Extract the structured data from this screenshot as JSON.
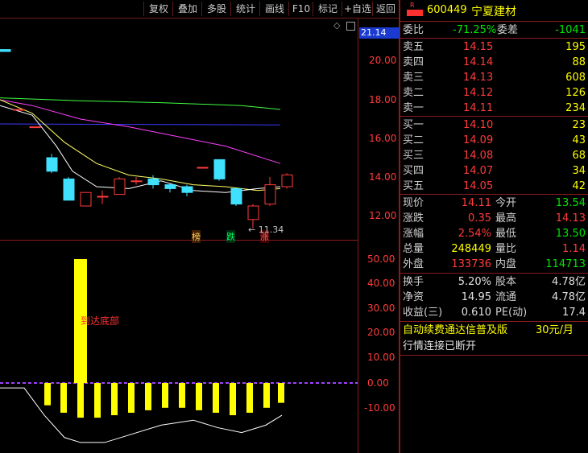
{
  "toolbar": {
    "buttons": [
      "复权",
      "叠加",
      "多股",
      "统计",
      "画线",
      "F10",
      "标记",
      "+自选",
      "返回"
    ]
  },
  "chart": {
    "price_axis": [
      "20.00",
      "18.00",
      "16.00",
      "14.00",
      "12.00"
    ],
    "price_badge": "21.14",
    "low_marker": "11.34",
    "markers": {
      "bang": "榜",
      "die": "跌",
      "zhang": "涨"
    },
    "indicator_axis": [
      "50.00",
      "40.00",
      "30.00",
      "20.00",
      "10.00",
      "0.00",
      "-10.00"
    ],
    "indicator_annotation": "到达底部",
    "colors": {
      "up": "#ff3b3b",
      "down": "#40e0ff",
      "ma1": "#ffffff",
      "ma2": "#ffff66",
      "ma3": "#ff40ff",
      "ma4": "#40ff40",
      "ma5": "#3a3aff",
      "bar": "#ffff00"
    }
  },
  "chart_data": {
    "type": "candlestick",
    "y_range": [
      11.0,
      21.2
    ],
    "candles": [
      {
        "o": 20.6,
        "h": 20.6,
        "l": 20.5,
        "c": 20.5
      },
      {
        "o": 17.5,
        "h": 17.5,
        "l": 17.5,
        "c": 17.5
      },
      {
        "o": 16.6,
        "h": 16.6,
        "l": 16.6,
        "c": 16.6
      },
      {
        "o": 15.0,
        "h": 15.2,
        "l": 14.2,
        "c": 14.3
      },
      {
        "o": 13.9,
        "h": 14.0,
        "l": 12.8,
        "c": 12.8
      },
      {
        "o": 12.5,
        "h": 13.2,
        "l": 12.5,
        "c": 13.2
      },
      {
        "o": 13.0,
        "h": 13.3,
        "l": 12.6,
        "c": 13.0
      },
      {
        "o": 13.1,
        "h": 14.0,
        "l": 13.1,
        "c": 13.9
      },
      {
        "o": 13.8,
        "h": 14.0,
        "l": 13.6,
        "c": 13.8
      },
      {
        "o": 13.9,
        "h": 14.1,
        "l": 13.4,
        "c": 13.6
      },
      {
        "o": 13.6,
        "h": 13.7,
        "l": 13.2,
        "c": 13.4
      },
      {
        "o": 13.5,
        "h": 13.6,
        "l": 13.0,
        "c": 13.2
      },
      {
        "o": 14.5,
        "h": 14.5,
        "l": 14.5,
        "c": 14.5
      },
      {
        "o": 14.9,
        "h": 14.9,
        "l": 13.8,
        "c": 13.9
      },
      {
        "o": 13.4,
        "h": 13.4,
        "l": 12.5,
        "c": 12.6
      },
      {
        "o": 11.8,
        "h": 12.6,
        "l": 11.34,
        "c": 12.5
      },
      {
        "o": 12.6,
        "h": 14.0,
        "l": 12.5,
        "c": 13.6
      },
      {
        "o": 13.5,
        "h": 14.2,
        "l": 13.4,
        "c": 14.11
      }
    ],
    "indicator": {
      "type": "bar",
      "y_range": [
        -15,
        53
      ],
      "values": [
        50,
        -9,
        -12,
        -14,
        -14,
        -13,
        -12,
        -11,
        -10,
        -10,
        -11,
        -12,
        -13,
        -12,
        -10,
        -8
      ]
    }
  },
  "panel": {
    "code": "600449",
    "name": "宁夏建材",
    "badge": "R",
    "weibi_label": "委比",
    "weibi_value": "-71.25%",
    "weicha_label": "委差",
    "weicha_value": "-1041",
    "asks": [
      {
        "label": "卖五",
        "price": "14.15",
        "vol": "195"
      },
      {
        "label": "卖四",
        "price": "14.14",
        "vol": "88"
      },
      {
        "label": "卖三",
        "price": "14.13",
        "vol": "608"
      },
      {
        "label": "卖二",
        "price": "14.12",
        "vol": "126"
      },
      {
        "label": "卖一",
        "price": "14.11",
        "vol": "234"
      }
    ],
    "bids": [
      {
        "label": "买一",
        "price": "14.10",
        "vol": "23"
      },
      {
        "label": "买二",
        "price": "14.09",
        "vol": "43"
      },
      {
        "label": "买三",
        "price": "14.08",
        "vol": "68"
      },
      {
        "label": "买四",
        "price": "14.07",
        "vol": "34"
      },
      {
        "label": "买五",
        "price": "14.05",
        "vol": "42"
      }
    ],
    "stats": [
      {
        "l1": "现价",
        "v1": "14.11",
        "l2": "今开",
        "v2": "13.54"
      },
      {
        "l1": "涨跌",
        "v1": "0.35",
        "l2": "最高",
        "v2": "14.13"
      },
      {
        "l1": "涨幅",
        "v1": "2.54%",
        "l2": "最低",
        "v2": "13.50"
      },
      {
        "l1": "总量",
        "v1": "248449",
        "l2": "量比",
        "v2": "1.14"
      },
      {
        "l1": "外盘",
        "v1": "133736",
        "l2": "内盘",
        "v2": "114713"
      }
    ],
    "stats2": [
      {
        "l1": "换手",
        "v1": "5.20%",
        "l2": "股本",
        "v2": "4.78亿"
      },
      {
        "l1": "净资",
        "v1": "14.95",
        "l2": "流通",
        "v2": "4.78亿"
      },
      {
        "l1": "收益(三)",
        "v1": "0.610",
        "l2": "PE(动)",
        "v2": "17.4"
      }
    ],
    "promo": "自动续费通达信普及版",
    "promo_price": "30元/月",
    "status": "行情连接已断开"
  }
}
